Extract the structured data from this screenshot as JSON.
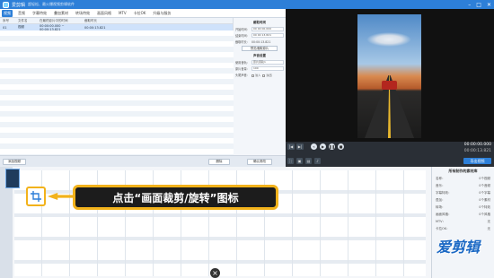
{
  "app": {
    "title": "爱剪辑",
    "subtitle": "超轻松、最火爆视频剪辑软件"
  },
  "tabs": [
    "视频",
    "音频",
    "字幕特效",
    "叠加素材",
    "转场特效",
    "画面风格",
    "MTV",
    "卡拉OK",
    "升级与服务"
  ],
  "list": {
    "headers": [
      "序号",
      "文件名",
      "在最终影片中的时间",
      "截取时长"
    ],
    "row": {
      "num": "01",
      "name": "视频",
      "range": "00:00:00.000 ~ 00:00:13.821",
      "dur": "00:00:13.821"
    }
  },
  "props": {
    "section_clip": "截取时间",
    "start_label": "开始时间：",
    "start_value": "00 00 00.000",
    "end_label": "结束时间：",
    "end_value": "00 00 13.821",
    "dur_label": "截取时长：",
    "dur_value": "00:00:13.821",
    "preview_btn": "预览/截取原片",
    "section_audio": "声音设置",
    "audio_track_label": "使用音轨：",
    "audio_track_value": "原片音轨1",
    "volume_label": "原片音量：",
    "volume_value": "100",
    "fade_label": "头尾声音：",
    "fade_in": "淡入",
    "fade_out": "淡出"
  },
  "listbar": {
    "add": "添加视频",
    "delete": "删除",
    "confirm": "确认修改"
  },
  "transport": {
    "time_current": "00:00:00.000",
    "time_total": "00:00:13.821",
    "export": "导出视频"
  },
  "callout": {
    "text": "点击“画面裁剪/旋转”图标"
  },
  "rightinfo": {
    "title": "所有制作的素材库",
    "items": [
      [
        "名称：",
        "0个视频"
      ],
      [
        "音乐：",
        "0个音频"
      ],
      [
        "字幕特效：",
        "0个字幕"
      ],
      [
        "叠加：",
        "0个素材"
      ],
      [
        "转场：",
        "0个特效"
      ],
      [
        "画面风格：",
        "0个风格"
      ],
      [
        "MTV：",
        "无"
      ],
      [
        "卡拉OK：",
        "无"
      ]
    ]
  },
  "watermark": "爱剪辑",
  "colors": {
    "accent": "#2d7fd8",
    "highlight": "#f2b21b",
    "selected_row": "#cfe2fb"
  }
}
